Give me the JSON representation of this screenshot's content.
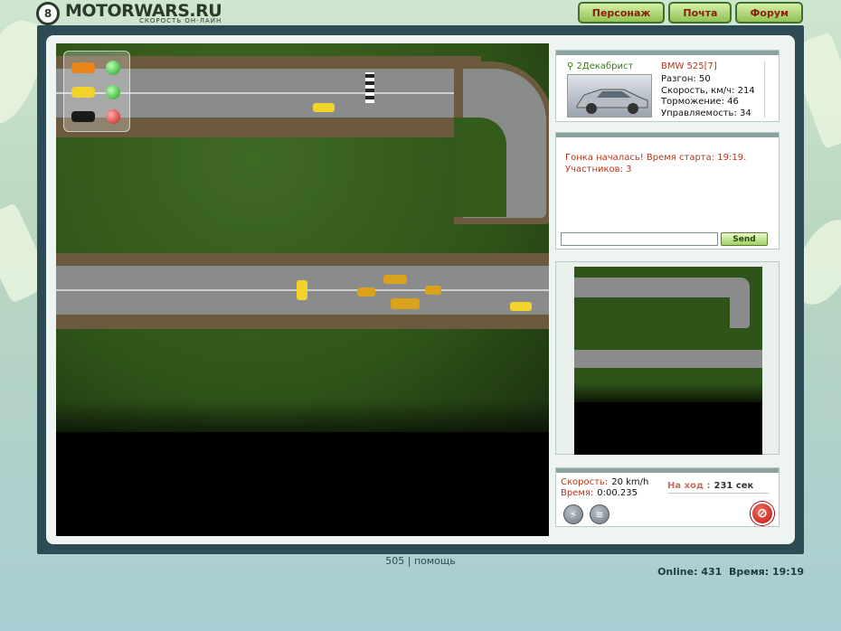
{
  "brand": {
    "name": "MOTORWARS.RU",
    "tagline": "СКОРОСТЬ ОН-ЛАЙН",
    "mark": "8"
  },
  "topnav": [
    {
      "label": "Персонаж"
    },
    {
      "label": "Почта"
    },
    {
      "label": "Форум"
    }
  ],
  "race": {
    "participants": [
      {
        "color": "#e8841a",
        "light": "green"
      },
      {
        "color": "#f1d32a",
        "light": "green"
      },
      {
        "color": "#1a1a1a",
        "light": "red"
      }
    ]
  },
  "car_info": {
    "player": "2Декабрист",
    "model": "BMW 525[7]",
    "stats": [
      {
        "label": "Разгон",
        "value": "50"
      },
      {
        "label": "Скорость, км/ч",
        "value": "214"
      },
      {
        "label": "Торможение",
        "value": "46"
      },
      {
        "label": "Управляемость",
        "value": "34"
      }
    ]
  },
  "chat": {
    "message_line1": "Гонка началась! Время старта: 19:19.",
    "message_line2": "Участников: 3",
    "input_value": "",
    "send_label": "Send"
  },
  "status": {
    "speed_label": "Скорость:",
    "speed_value": "20 km/h",
    "time_label": "Время:",
    "time_value": "0:00.235",
    "turn_label": "На ход :",
    "turn_value": "231 сек"
  },
  "footer": {
    "code": "505",
    "separator": "|",
    "help": "помощь",
    "online_label": "Online:",
    "online_value": "431",
    "time_label": "Время:",
    "time_value": "19:19"
  },
  "colors": {
    "frame": "#2c4b54",
    "accent_red": "#b4381c",
    "nav_text": "#8a1d0d",
    "grass": "#2f5419",
    "road": "#8a8c8c"
  }
}
